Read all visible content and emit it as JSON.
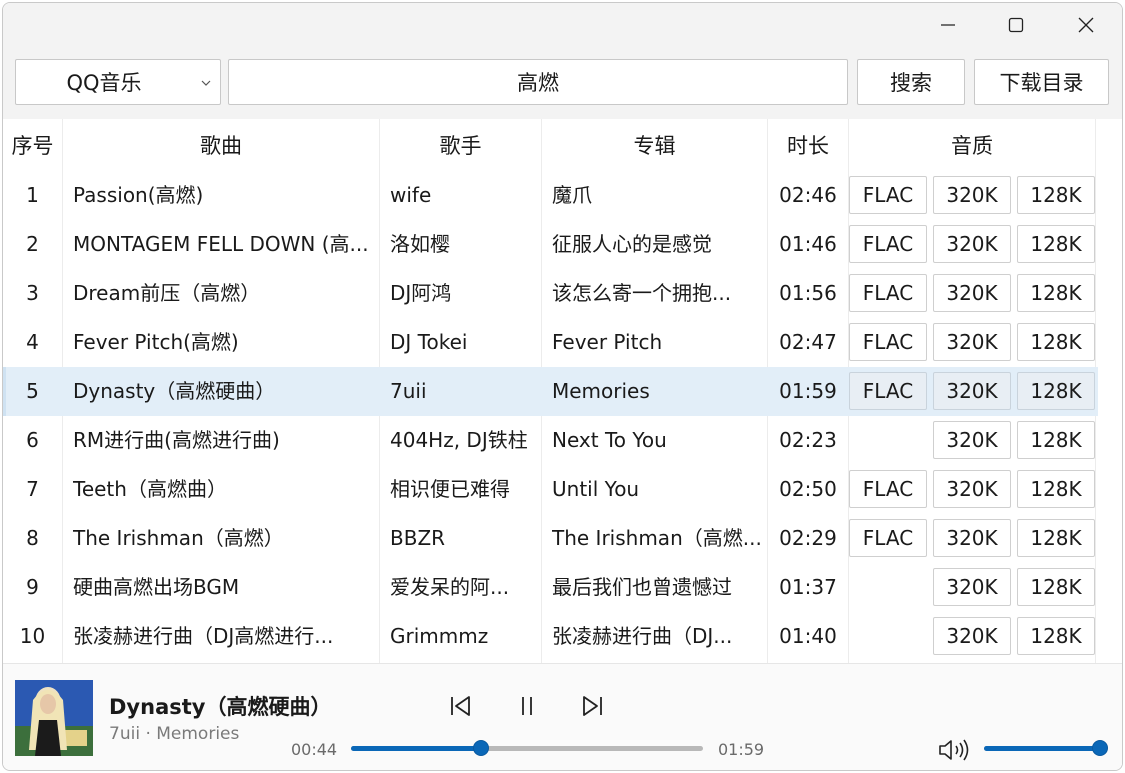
{
  "toolbar": {
    "source": "QQ音乐",
    "query": "高燃",
    "search_label": "搜索",
    "download_dir_label": "下载目录"
  },
  "columns": [
    "序号",
    "歌曲",
    "歌手",
    "专辑",
    "时长",
    "音质"
  ],
  "rows": [
    {
      "n": "1",
      "song": "Passion(高燃)",
      "artist": "wife",
      "album": "魔爪",
      "dur": "02:46",
      "flac": "FLAC",
      "q320": "320K",
      "q128": "128K"
    },
    {
      "n": "2",
      "song": "MONTAGEM FELL DOWN (高...",
      "artist": "洛如樱",
      "album": "征服人心的是感觉",
      "dur": "01:46",
      "flac": "FLAC",
      "q320": "320K",
      "q128": "128K"
    },
    {
      "n": "3",
      "song": "Dream前压（高燃）",
      "artist": "DJ阿鸿",
      "album": "该怎么寄一个拥抱...",
      "dur": "01:56",
      "flac": "FLAC",
      "q320": "320K",
      "q128": "128K"
    },
    {
      "n": "4",
      "song": "Fever Pitch(高燃)",
      "artist": "DJ Tokei",
      "album": "Fever Pitch",
      "dur": "02:47",
      "flac": "FLAC",
      "q320": "320K",
      "q128": "128K"
    },
    {
      "n": "5",
      "song": "Dynasty（高燃硬曲）",
      "artist": "7uii",
      "album": "Memories",
      "dur": "01:59",
      "flac": "FLAC",
      "q320": "320K",
      "q128": "128K"
    },
    {
      "n": "6",
      "song": "RM进行曲(高燃进行曲)",
      "artist": "404Hz, DJ铁柱",
      "album": "Next To You",
      "dur": "02:23",
      "flac": "",
      "q320": "320K",
      "q128": "128K"
    },
    {
      "n": "7",
      "song": "Teeth（高燃曲）",
      "artist": "相识便已难得",
      "album": "Until You",
      "dur": "02:50",
      "flac": "FLAC",
      "q320": "320K",
      "q128": "128K"
    },
    {
      "n": "8",
      "song": "The Irishman（高燃）",
      "artist": "BBZR",
      "album": "The Irishman（高燃...",
      "dur": "02:29",
      "flac": "FLAC",
      "q320": "320K",
      "q128": "128K"
    },
    {
      "n": "9",
      "song": "硬曲高燃出场BGM",
      "artist": "爱发呆的阿...",
      "album": "最后我们也曾遗憾过",
      "dur": "01:37",
      "flac": "",
      "q320": "320K",
      "q128": "128K"
    },
    {
      "n": "10",
      "song": "张凌赫进行曲（DJ高燃进行...",
      "artist": "Grimmmz",
      "album": "张凌赫进行曲（DJ...",
      "dur": "01:40",
      "flac": "",
      "q320": "320K",
      "q128": "128K"
    }
  ],
  "selected_row": 4,
  "player": {
    "title": "Dynasty（高燃硬曲）",
    "subtitle": "7uii · Memories",
    "elapsed": "00:44",
    "total": "01:59",
    "progress": 0.37,
    "volume": 1.0
  },
  "colors": {
    "accent": "#0a67b7",
    "selected_row_bg": "#e2eef8",
    "toolbar_bg": "#f3f3f3"
  },
  "icons": {
    "minimize": "minimize-icon",
    "maximize": "maximize-icon",
    "close": "close-icon",
    "dropdown": "chevron-down-icon",
    "previous": "skip-previous-icon",
    "pause": "pause-icon",
    "next": "skip-next-icon",
    "volume": "volume-icon"
  }
}
